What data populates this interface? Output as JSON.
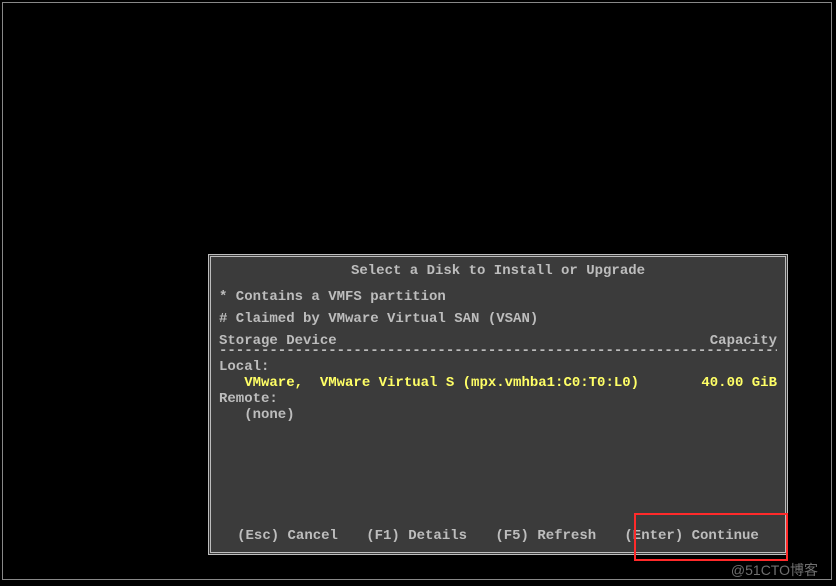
{
  "dialog": {
    "title": "Select a Disk to Install or Upgrade",
    "legend_line1": "* Contains a VMFS partition",
    "legend_line2": "# Claimed by VMware Virtual SAN (VSAN)",
    "columns": {
      "device": "Storage Device",
      "capacity": "Capacity"
    },
    "rule": "---------------------------------------------------------------------",
    "sections": {
      "local_label": "Local:",
      "remote_label": "Remote:",
      "none_text": "   (none)"
    },
    "selected_disk": {
      "name": "   VMware,  VMware Virtual S (mpx.vmhba1:C0:T0:L0)",
      "capacity": "40.00 GiB"
    },
    "actions": {
      "esc": "(Esc) Cancel",
      "f1": "(F1) Details",
      "f5": "(F5) Refresh",
      "enter": "(Enter) Continue"
    }
  },
  "watermark": "@51CTO博客"
}
